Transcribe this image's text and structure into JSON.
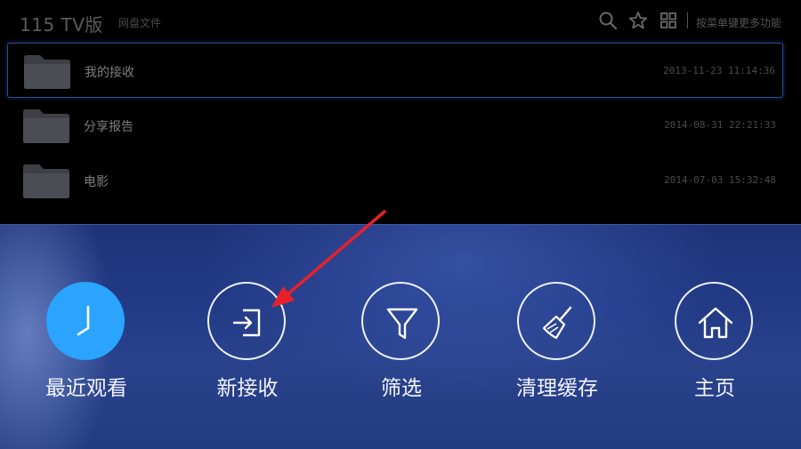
{
  "header": {
    "app_title": "115 TV版",
    "breadcrumb": "网盘文件",
    "menu_hint": "按菜单键更多功能",
    "icons": [
      "search-icon",
      "star-icon",
      "grid-icon"
    ]
  },
  "files": [
    {
      "name": "我的接收",
      "date": "2013-11-23 11:14:36",
      "selected": true
    },
    {
      "name": "分享报告",
      "date": "2014-08-31 22:21:33",
      "selected": false
    },
    {
      "name": "电影",
      "date": "2014-07-03 15:32:48",
      "selected": false
    }
  ],
  "menu": {
    "items": [
      {
        "label": "最近观看",
        "icon": "clock-icon",
        "active": true
      },
      {
        "label": "新接收",
        "icon": "enter-icon",
        "active": false
      },
      {
        "label": "筛选",
        "icon": "filter-icon",
        "active": false
      },
      {
        "label": "清理缓存",
        "icon": "broom-icon",
        "active": false
      },
      {
        "label": "主页",
        "icon": "home-icon",
        "active": false
      }
    ]
  },
  "colors": {
    "accent": "#2aa4ff",
    "panel": "#223a86",
    "annotation": "#e8202a"
  }
}
